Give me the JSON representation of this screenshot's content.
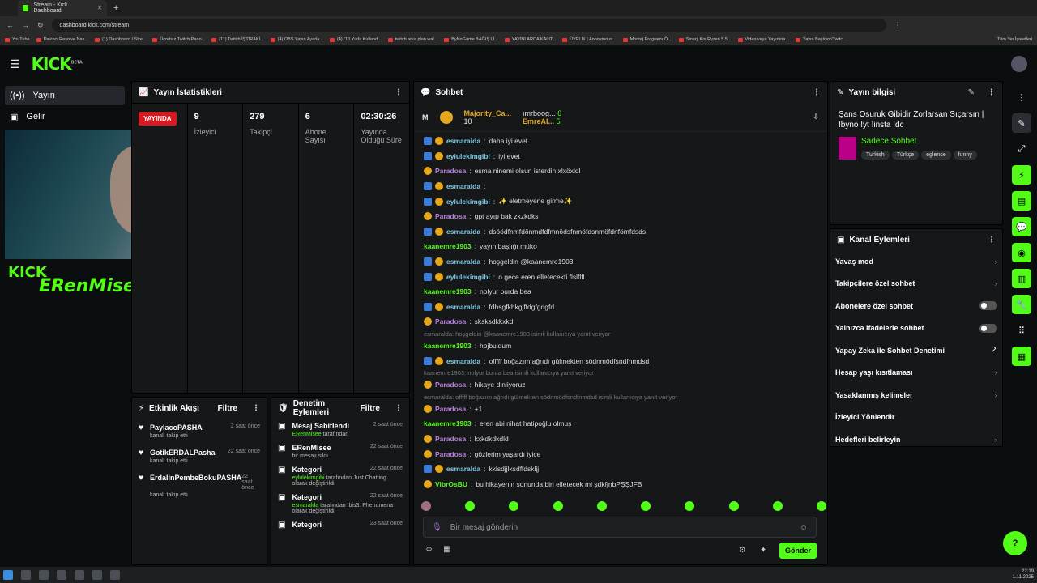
{
  "browser": {
    "tab_title": "Stream - Kick Dashboard",
    "url": "dashboard.kick.com/stream",
    "bookmarks": [
      "YouTube",
      "Davinci Resolve Nas...",
      "(1) Dashboard / Stre...",
      "Ücretsiz Twitch Pano...",
      "(11) Twitch İŞTİRAKİ...",
      "(4) OBS Yayın Ayarla...",
      "(4) \"10 Yılda Kulland...",
      "twitch arka plan wal...",
      "ByNoGame BAĞIŞ Lİ...",
      "YAYINLARDA KALIT...",
      "ÜYELİK | Anonymous...",
      "Montaj Programı Öl...",
      "Sinerji Koi Ryzen 5 5...",
      "Video veya Yayınına...",
      "Yayın Başlıyor/Twitc..."
    ],
    "all_bookmarks": "Tüm Yer İşaretleri"
  },
  "brand": {
    "logo": "KICK",
    "beta": "BETA"
  },
  "nav": [
    {
      "icon": "broadcast",
      "label": "Yayın"
    },
    {
      "icon": "money",
      "label": "Gelir"
    }
  ],
  "overlay": {
    "kick": "KICK",
    "name": "ERenMisee"
  },
  "stats": {
    "title": "Yayın İstatistikleri",
    "live": "YAYINDA",
    "viewers": {
      "value": "9",
      "label": "İzleyici"
    },
    "followers": {
      "value": "279",
      "label": "Takipçi"
    },
    "subs": {
      "value": "6",
      "label": "Abone Sayısı"
    },
    "uptime": {
      "value": "02:30:26",
      "label": "Yayında Olduğu Süre"
    }
  },
  "activity": {
    "title": "Etkinlik Akışı",
    "filter": "Filtre",
    "items": [
      {
        "name": "PaylacoPASHA",
        "time": "2 saat önce",
        "text": "kanalı takip etti"
      },
      {
        "name": "GotikERDALPasha",
        "time": "22 saat önce",
        "text": "kanalı takip etti"
      },
      {
        "name": "ErdalinPembeBokuPASHA",
        "time": "22 saat önce",
        "text": "kanalı takip etti"
      }
    ]
  },
  "modlog": {
    "title": "Denetim Eylemleri",
    "filter": "Filtre",
    "items": [
      {
        "title": "Mesaj Sabitlendi",
        "time": "2 saat önce",
        "a": "ERenMisee",
        "b": " tarafından"
      },
      {
        "title": "ERenMisee",
        "time": "22 saat önce",
        "a": "",
        "b": "bir mesajı sildi"
      },
      {
        "title": "Kategori",
        "time": "22 saat önce",
        "a": "eylulekimgibi",
        "b": " tarafından Just Chatting olarak değiştirildi"
      },
      {
        "title": "Kategori",
        "time": "22 saat önce",
        "a": "esmaralda",
        "b": " tarafından Ibis3: Phenomena olarak değiştirildi"
      },
      {
        "title": "Kategori",
        "time": "23 saat önce",
        "a": "",
        "b": ""
      }
    ]
  },
  "chat": {
    "title": "Sohbet",
    "top1": {
      "name": "Majority_Ca...",
      "count": "10"
    },
    "top2": {
      "name": "ımrboog...",
      "count": "6"
    },
    "top3": {
      "name": "EmreAl...",
      "count": "5"
    },
    "messages": [
      {
        "u": "esmaralda",
        "c": "#7ec8e3",
        "t": "daha iyi evet",
        "mod": true
      },
      {
        "u": "eylulekimgibi",
        "c": "#7ec8e3",
        "t": "iyi evet",
        "mod": true
      },
      {
        "u": "Paradosa",
        "c": "#b57edc",
        "t": "esma ninemi olsun isterdin xlxöxldl",
        "mod": false
      },
      {
        "u": "esmaralda",
        "c": "#7ec8e3",
        "t": "",
        "mod": true
      },
      {
        "u": "eylulekimgibi",
        "c": "#7ec8e3",
        "t": "✨ eletmeyene girme✨",
        "mod": true
      },
      {
        "u": "Paradosa",
        "c": "#b57edc",
        "t": "gpt ayıp bak zkzkdks",
        "mod": false
      },
      {
        "u": "esmaralda",
        "c": "#7ec8e3",
        "t": "dsöödfnmfdönmdfdfmnödsfnmöfdsnmöfdnfömfdsds",
        "mod": true
      },
      {
        "u": "kaanemre1903",
        "c": "#53fc18",
        "t": "yayın başlığı müko",
        "mod": false,
        "nobadge": true
      },
      {
        "u": "esmaralda",
        "c": "#7ec8e3",
        "t": "hoşgeldin @kaanemre1903",
        "mod": true
      },
      {
        "u": "eylulekimgibi",
        "c": "#7ec8e3",
        "t": "o gece eren elletecekti flslflfl",
        "mod": true
      },
      {
        "u": "kaanemre1903",
        "c": "#53fc18",
        "t": "nolyur burda bea",
        "mod": false,
        "nobadge": true
      },
      {
        "u": "esmaralda",
        "c": "#7ec8e3",
        "t": "fdhsgfkhkgjffdgfgdgfd",
        "mod": true
      },
      {
        "u": "Paradosa",
        "c": "#b57edc",
        "t": "sksksdkkxkd",
        "mod": false
      },
      {
        "reply": "esmaralda: hoşgeldin @kaanemre1903 isimli kullanıcıya yanıt veriyor"
      },
      {
        "u": "kaanemre1903",
        "c": "#53fc18",
        "t": "hojbuldum",
        "mod": false,
        "nobadge": true
      },
      {
        "u": "esmaralda",
        "c": "#7ec8e3",
        "t": "offfff boğazım ağrıdı gülmekten södnmödfsndfnmdsd",
        "mod": true
      },
      {
        "reply": "kaanemre1903: nolyur burda bea isimli kullanıcıya yanıt veriyor"
      },
      {
        "u": "Paradosa",
        "c": "#b57edc",
        "t": "hikaye dinliyoruz",
        "mod": false
      },
      {
        "reply": "esmaralda: offfff boğazım ağrıdı gülmekten södnmödfsndfnmdsd isimli kullanıcıya yanıt veriyor"
      },
      {
        "u": "Paradosa",
        "c": "#b57edc",
        "t": "+1",
        "mod": false
      },
      {
        "u": "kaanemre1903",
        "c": "#53fc18",
        "t": "eren abi nihat hatipoğlu olmuş",
        "mod": false,
        "nobadge": true
      },
      {
        "u": "Paradosa",
        "c": "#b57edc",
        "t": "kxkdkdkdld",
        "mod": false
      },
      {
        "u": "Paradosa",
        "c": "#b57edc",
        "t": "gözlerim yaşardı iyice",
        "mod": false
      },
      {
        "u": "esmaralda",
        "c": "#7ec8e3",
        "t": "kklsdjjlksdffdskljj",
        "mod": true
      },
      {
        "u": "VibrOsBU",
        "c": "#53fc18",
        "t": "bu hikayenin sonunda biri elletecek mi şdkfjnbPŞŞJFB",
        "mod": false
      }
    ],
    "placeholder": "Bir mesaj gönderin",
    "send": "Gönder"
  },
  "info": {
    "title": "Yayın bilgisi",
    "stream_title": "Şans Osuruk Gibidir Zorlarsan Sıçarsın | !byno !yt !insta !dc",
    "category": "Sadece Sohbet",
    "tags": [
      "Turkish",
      "Türkçe",
      "eglence",
      "funny"
    ]
  },
  "actions": {
    "title": "Kanal Eylemleri",
    "items": [
      {
        "label": "Yavaş mod",
        "kind": "arrow"
      },
      {
        "label": "Takipçilere özel sohbet",
        "kind": "arrow"
      },
      {
        "label": "Abonelere özel sohbet",
        "kind": "toggle"
      },
      {
        "label": "Yalnızca ifadelerle sohbet",
        "kind": "toggle"
      },
      {
        "label": "Yapay Zeka ile Sohbet Denetimi",
        "kind": "ext"
      },
      {
        "label": "Hesap yaşı kısıtlaması",
        "kind": "arrow"
      },
      {
        "label": "Yasaklanmış kelimeler",
        "kind": "arrow"
      },
      {
        "label": "İzleyici Yönlendir",
        "kind": "none"
      },
      {
        "label": "Hedefleri belirleyin",
        "kind": "arrow"
      }
    ]
  },
  "taskbar": {
    "time": "22:19",
    "date": "1.11.2025"
  }
}
